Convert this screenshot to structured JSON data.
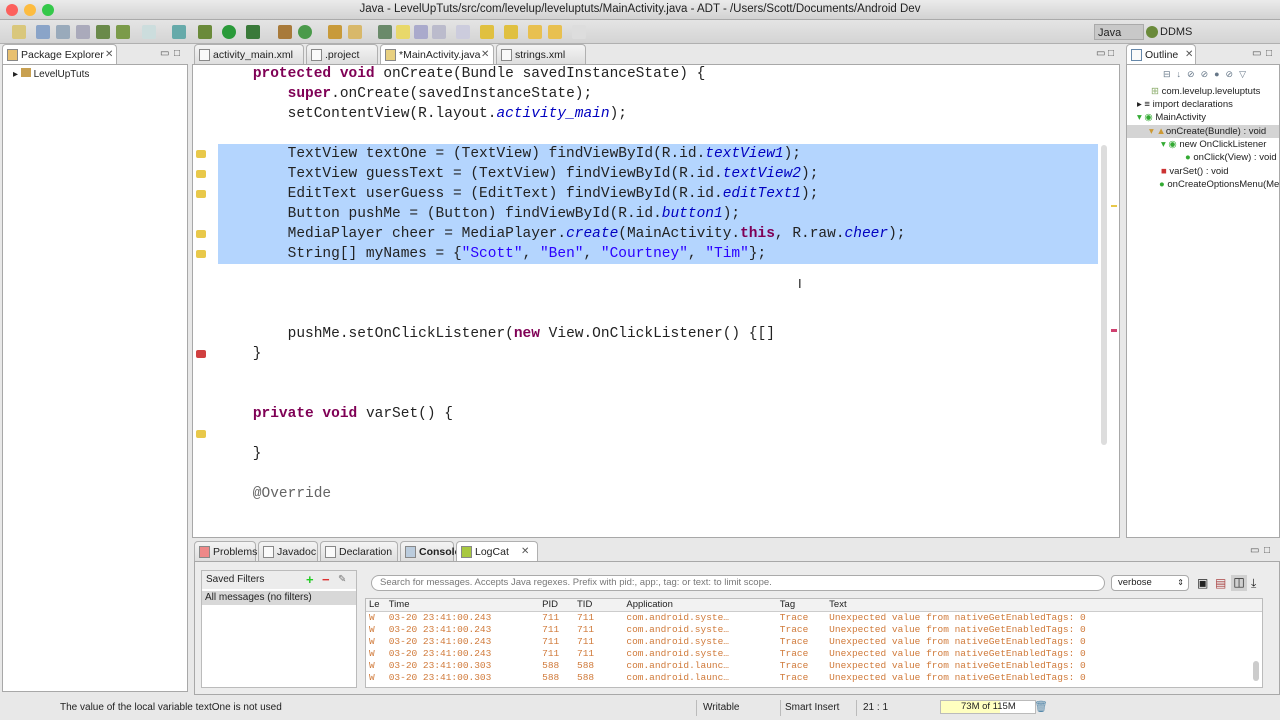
{
  "window": {
    "title": "Java - LevelUpTuts/src/com/levelup/leveluptuts/MainActivity.java - ADT - /Users/Scott/Documents/Android Dev"
  },
  "perspectives": [
    "Java",
    "DDMS"
  ],
  "package_explorer": {
    "title": "Package Explorer",
    "items": [
      "LevelUpTuts"
    ]
  },
  "editor_tabs": [
    {
      "label": "activity_main.xml"
    },
    {
      "label": ".project"
    },
    {
      "label": "*MainActivity.java"
    },
    {
      "label": "strings.xml"
    }
  ],
  "code_lines": [
    [
      [
        "    "
      ],
      [
        "protected void ",
        "kw"
      ],
      [
        "onCreate(Bundle savedInstanceState) {"
      ]
    ],
    [
      [
        "        "
      ],
      [
        "super",
        "kw"
      ],
      [
        ".onCreate(savedInstanceState);"
      ]
    ],
    [
      [
        "        setContentView(R.layout."
      ],
      [
        "activity_main",
        "fld"
      ],
      [
        ");"
      ]
    ],
    [
      [
        ""
      ]
    ],
    [
      [
        "        TextView textOne = (TextView) findViewById(R.id."
      ],
      [
        "textView1",
        "fld"
      ],
      [
        ");"
      ]
    ],
    [
      [
        "        TextView guessText = (TextView) findViewById(R.id."
      ],
      [
        "textView2",
        "fld"
      ],
      [
        ");"
      ]
    ],
    [
      [
        "        EditText userGuess = (EditText) findViewById(R.id."
      ],
      [
        "editText1",
        "fld"
      ],
      [
        ");"
      ]
    ],
    [
      [
        "        Button pushMe = (Button) findViewById(R.id."
      ],
      [
        "button1",
        "fld"
      ],
      [
        ");"
      ]
    ],
    [
      [
        "        MediaPlayer cheer = MediaPlayer."
      ],
      [
        "create",
        "fld"
      ],
      [
        "(MainActivity."
      ],
      [
        "this",
        "kw"
      ],
      [
        ", R.raw."
      ],
      [
        "cheer",
        "fld"
      ],
      [
        ");"
      ]
    ],
    [
      [
        "        String[] myNames = {"
      ],
      [
        "\"Scott\"",
        "str"
      ],
      [
        ", "
      ],
      [
        "\"Ben\"",
        "str"
      ],
      [
        ", "
      ],
      [
        "\"Courtney\"",
        "str"
      ],
      [
        ", "
      ],
      [
        "\"Tim\"",
        "str"
      ],
      [
        "};"
      ]
    ],
    [
      [
        ""
      ]
    ],
    [
      [
        ""
      ]
    ],
    [
      [
        ""
      ]
    ],
    [
      [
        "        pushMe.setOnClickListener("
      ],
      [
        "new ",
        "kw"
      ],
      [
        "View.OnClickListener() {[]"
      ]
    ],
    [
      [
        "    }"
      ]
    ],
    [
      [
        ""
      ]
    ],
    [
      [
        ""
      ]
    ],
    [
      [
        "    "
      ],
      [
        "private void ",
        "kw"
      ],
      [
        "varSet() {"
      ]
    ],
    [
      [
        ""
      ]
    ],
    [
      [
        "    }"
      ]
    ],
    [
      [
        ""
      ]
    ],
    [
      [
        "    @Override",
        "ann"
      ]
    ]
  ],
  "outline": {
    "title": "Outline",
    "items": [
      "com.levelup.leveluptuts",
      "import declarations",
      "MainActivity",
      "onCreate(Bundle) : void",
      "new OnClickListener",
      "onClick(View) : void",
      "varSet() : void",
      "onCreateOptionsMenu(Menu)"
    ]
  },
  "bottom_tabs": [
    "Problems",
    "Javadoc",
    "Declaration",
    "Console",
    "LogCat"
  ],
  "logcat": {
    "saved_filters": "Saved Filters",
    "all_messages": "All messages (no filters)",
    "search_placeholder": "Search for messages. Accepts Java regexes. Prefix with pid:, app:, tag: or text: to limit scope.",
    "level": "verbose",
    "columns": [
      "Le",
      "Time",
      "PID",
      "TID",
      "Application",
      "Tag",
      "Text"
    ],
    "rows": [
      [
        "W",
        "03-20 23:41:00.243",
        "711",
        "711",
        "com.android.syste…",
        "Trace",
        "Unexpected value from nativeGetEnabledTags: 0"
      ],
      [
        "W",
        "03-20 23:41:00.243",
        "711",
        "711",
        "com.android.syste…",
        "Trace",
        "Unexpected value from nativeGetEnabledTags: 0"
      ],
      [
        "W",
        "03-20 23:41:00.243",
        "711",
        "711",
        "com.android.syste…",
        "Trace",
        "Unexpected value from nativeGetEnabledTags: 0"
      ],
      [
        "W",
        "03-20 23:41:00.243",
        "711",
        "711",
        "com.android.syste…",
        "Trace",
        "Unexpected value from nativeGetEnabledTags: 0"
      ],
      [
        "W",
        "03-20 23:41:00.303",
        "588",
        "588",
        "com.android.launc…",
        "Trace",
        "Unexpected value from nativeGetEnabledTags: 0"
      ],
      [
        "W",
        "03-20 23:41:00.303",
        "588",
        "588",
        "com.android.launc…",
        "Trace",
        "Unexpected value from nativeGetEnabledTags: 0"
      ]
    ]
  },
  "status": {
    "message": "The value of the local variable textOne is not used",
    "writable": "Writable",
    "insert_mode": "Smart Insert",
    "position": "21 : 1",
    "memory": "73M of 115M",
    "memory_fraction": 0.63
  }
}
